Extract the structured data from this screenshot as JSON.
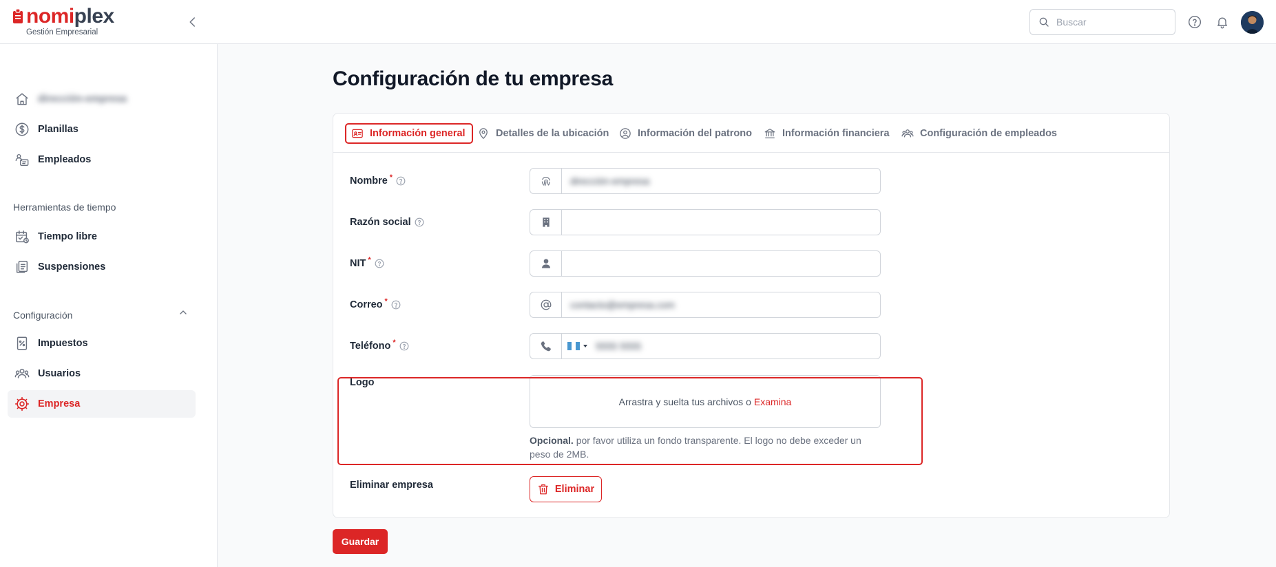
{
  "brand": {
    "name_part1": "nomi",
    "name_part2": "plex",
    "tagline": "Gestión Empresarial",
    "colors": {
      "accent": "#dc2626",
      "dark": "#374151"
    }
  },
  "header": {
    "search_placeholder": "Buscar",
    "icons": [
      "chevron-left-icon",
      "search-icon",
      "help-icon",
      "bell-icon"
    ]
  },
  "sidebar": {
    "items": [
      {
        "label": "dirección-empresa",
        "icon": "home-icon",
        "blurred": true
      },
      {
        "label": "Planillas",
        "icon": "dollar-circle-icon"
      },
      {
        "label": "Empleados",
        "icon": "employees-icon"
      }
    ],
    "section_time": {
      "label": "Herramientas de tiempo",
      "items": [
        {
          "label": "Tiempo libre",
          "icon": "calendar-check-icon"
        },
        {
          "label": "Suspensiones",
          "icon": "clipboard-icon"
        }
      ]
    },
    "section_config": {
      "label": "Configuración",
      "expanded": true,
      "items": [
        {
          "label": "Impuestos",
          "icon": "percent-doc-icon"
        },
        {
          "label": "Usuarios",
          "icon": "users-icon"
        },
        {
          "label": "Empresa",
          "icon": "gear-icon",
          "active": true
        }
      ]
    }
  },
  "main": {
    "title": "Configuración de tu empresa",
    "tabs": [
      {
        "label": "Información general",
        "icon": "id-card-icon",
        "active": true
      },
      {
        "label": "Detalles de la ubicación",
        "icon": "map-pin-icon"
      },
      {
        "label": "Información del patrono",
        "icon": "user-circle-icon"
      },
      {
        "label": "Información financiera",
        "icon": "bank-icon"
      },
      {
        "label": "Configuración de empleados",
        "icon": "users-icon"
      }
    ],
    "fields": {
      "nombre": {
        "label": "Nombre",
        "required": true,
        "icon": "fingerprint-icon",
        "value": "dirección-empresa"
      },
      "razon_social": {
        "label": "Razón social",
        "required": false,
        "icon": "building-icon",
        "value": ""
      },
      "nit": {
        "label": "NIT",
        "required": true,
        "icon": "person-icon",
        "value": ""
      },
      "correo": {
        "label": "Correo",
        "required": true,
        "icon": "at-icon",
        "value": "contacto@empresa.com"
      },
      "telefono": {
        "label": "Teléfono",
        "required": true,
        "icon": "phone-icon",
        "country_flag": "guatemala-flag",
        "value": "5555 5555"
      }
    },
    "logo": {
      "label": "Logo",
      "drop_text": "Arrastra y suelta tus archivos o",
      "browse_link": "Examina",
      "note_bold": "Opcional.",
      "note_text": "por favor utiliza un fondo transparente. El logo no debe exceder un peso de 2MB."
    },
    "delete": {
      "label": "Eliminar empresa",
      "button": "Eliminar",
      "icon": "trash-icon"
    },
    "required_mark": "*",
    "save_button": "Guardar"
  }
}
